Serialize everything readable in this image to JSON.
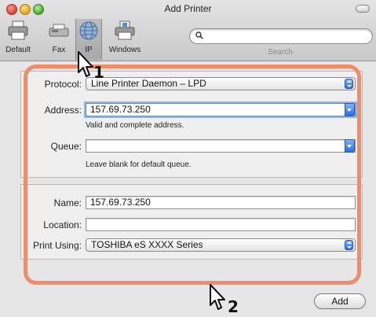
{
  "window": {
    "title": "Add Printer"
  },
  "toolbar": {
    "items": [
      {
        "label": "Default",
        "icon": "default-printer-icon"
      },
      {
        "label": "Fax",
        "icon": "fax-icon"
      },
      {
        "label": "IP",
        "icon": "ip-globe-icon",
        "selected": true
      },
      {
        "label": "Windows",
        "icon": "windows-printer-icon"
      }
    ],
    "search": {
      "placeholder": "",
      "caption": "Search"
    }
  },
  "form": {
    "protocol": {
      "label": "Protocol:",
      "value": "Line Printer Daemon – LPD"
    },
    "address": {
      "label": "Address:",
      "value": "157.69.73.250",
      "hint": "Valid and complete address."
    },
    "queue": {
      "label": "Queue:",
      "value": "",
      "hint": "Leave blank for default queue."
    },
    "name": {
      "label": "Name:",
      "value": "157.69.73.250"
    },
    "location": {
      "label": "Location:",
      "value": ""
    },
    "print_using": {
      "label": "Print Using:",
      "value": "TOSHIBA eS XXXX Series"
    }
  },
  "buttons": {
    "add": "Add"
  },
  "annotations": {
    "step1": "1",
    "step2": "2"
  },
  "colors": {
    "highlight": "#ef8d6b",
    "accent": "#2a6fe0"
  }
}
